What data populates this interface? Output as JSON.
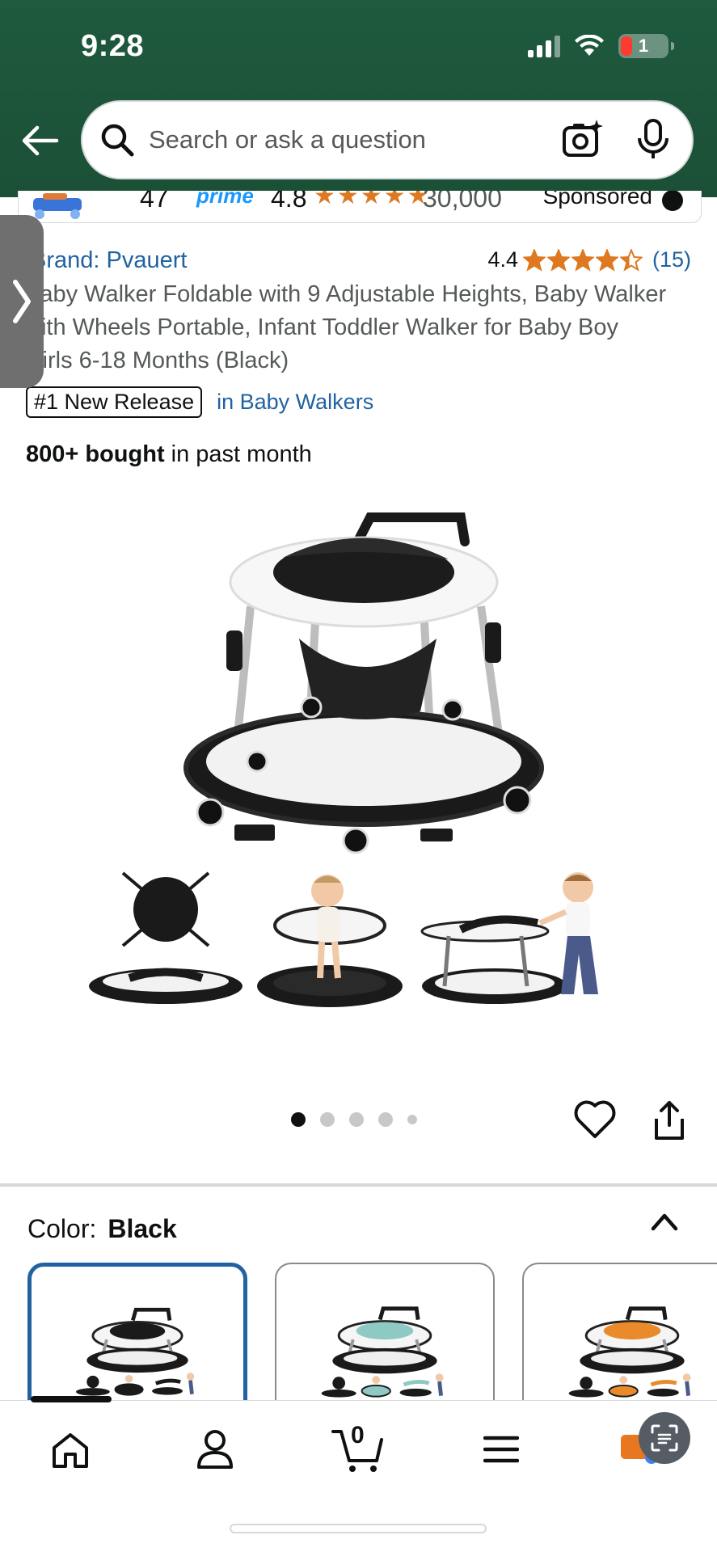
{
  "status_bar": {
    "time": "9:28",
    "battery": "1"
  },
  "search": {
    "placeholder": "Search or ask a question"
  },
  "sponsored_strip": {
    "count": "47",
    "prime": "prime",
    "rating": "4.8",
    "reviews": "30,000",
    "label": "Sponsored"
  },
  "product": {
    "brand": "Brand: Pvauert",
    "rating_value": "4.4",
    "rating_stars": 4.4,
    "rating_count": "(15)",
    "title": "Baby Walker Foldable with 9 Adjustable Heights, Baby Walker with Wheels Portable, Infant Toddler Walker for Baby Boy Girls 6-18 Months (Black)",
    "badge": "#1 New Release",
    "badge_category": "in Baby Walkers",
    "bought_strong": "800+ bought",
    "bought_rest": " in past month"
  },
  "carousel": {
    "total": 5,
    "active": 0
  },
  "color": {
    "label": "Color:",
    "value": "Black"
  },
  "swatches": [
    {
      "name": "Black",
      "accent": "#1a1a1a",
      "selected": true
    },
    {
      "name": "Green",
      "accent": "#8ec9c4",
      "selected": false
    },
    {
      "name": "Orange",
      "accent": "#e98b2a",
      "selected": false
    }
  ],
  "bottom_nav": {
    "cart_count": "0"
  },
  "colors": {
    "header": "#1f5a3e",
    "link": "#2162a1",
    "star": "#de7921",
    "selected_border": "#2162a1"
  }
}
